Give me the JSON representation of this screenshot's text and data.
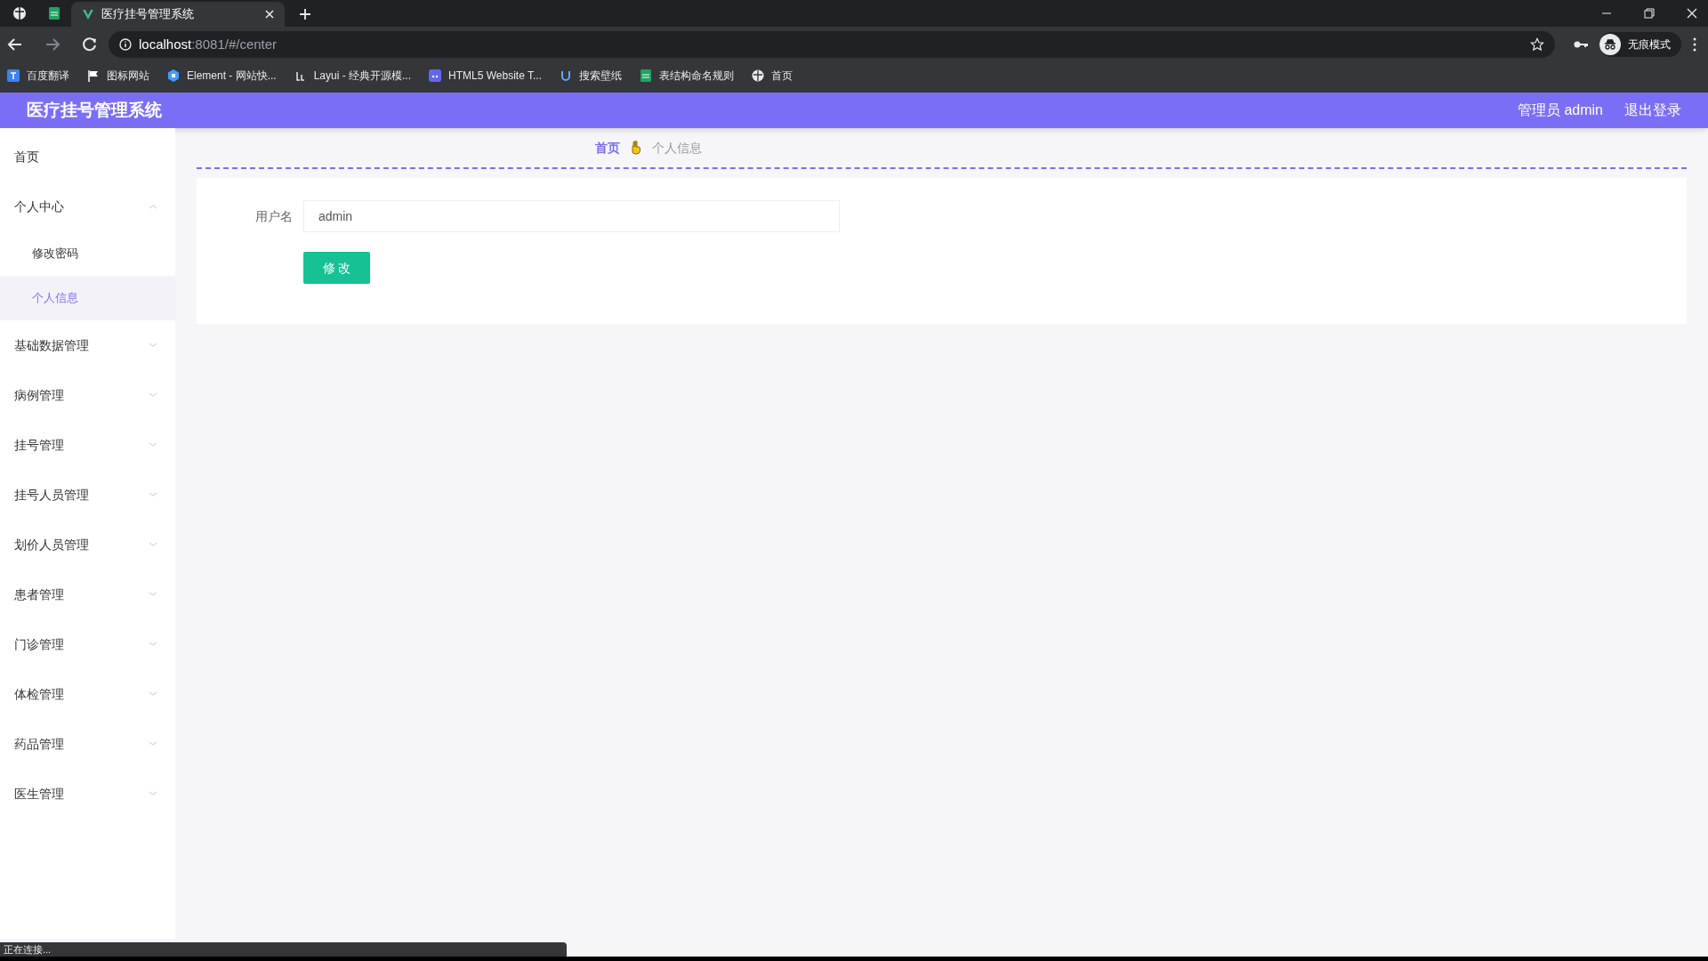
{
  "browser": {
    "tabs": [
      {
        "title": "医疗挂号管理系统",
        "selected": true
      }
    ],
    "address": {
      "host": "localhost",
      "path": ":8081/#/center"
    },
    "bookmarks": [
      "百度翻译",
      "图标网站",
      "Element - 网站快...",
      "Layui - 经典开源模...",
      "HTML5 Website T...",
      "搜索壁纸",
      "表结构命名规则",
      "首页"
    ],
    "profile": "无痕模式",
    "status": "正在连接..."
  },
  "app": {
    "title": "医疗挂号管理系统",
    "user": "管理员 admin",
    "logout": "退出登录"
  },
  "sidebar": {
    "items": [
      {
        "label": "首页",
        "kind": "link",
        "selected": false
      },
      {
        "label": "个人中心",
        "kind": "group",
        "expanded": true,
        "selected": false,
        "children": [
          {
            "label": "修改密码",
            "selected": false
          },
          {
            "label": "个人信息",
            "selected": true
          }
        ]
      },
      {
        "label": "基础数据管理",
        "kind": "group",
        "expanded": false,
        "selected": false
      },
      {
        "label": "病例管理",
        "kind": "group",
        "expanded": false,
        "selected": false
      },
      {
        "label": "挂号管理",
        "kind": "group",
        "expanded": false,
        "selected": false
      },
      {
        "label": "挂号人员管理",
        "kind": "group",
        "expanded": false,
        "selected": false
      },
      {
        "label": "划价人员管理",
        "kind": "group",
        "expanded": false,
        "selected": false
      },
      {
        "label": "患者管理",
        "kind": "group",
        "expanded": false,
        "selected": false
      },
      {
        "label": "门诊管理",
        "kind": "group",
        "expanded": false,
        "selected": false
      },
      {
        "label": "体检管理",
        "kind": "group",
        "expanded": false,
        "selected": false
      },
      {
        "label": "药品管理",
        "kind": "group",
        "expanded": false,
        "selected": false
      },
      {
        "label": "医生管理",
        "kind": "group",
        "expanded": false,
        "selected": false
      }
    ]
  },
  "breadcrumb": [
    "首页",
    "个人信息"
  ],
  "form": {
    "fields": [
      {
        "label": "用户名",
        "value": "admin"
      }
    ],
    "submit": "修 改"
  }
}
